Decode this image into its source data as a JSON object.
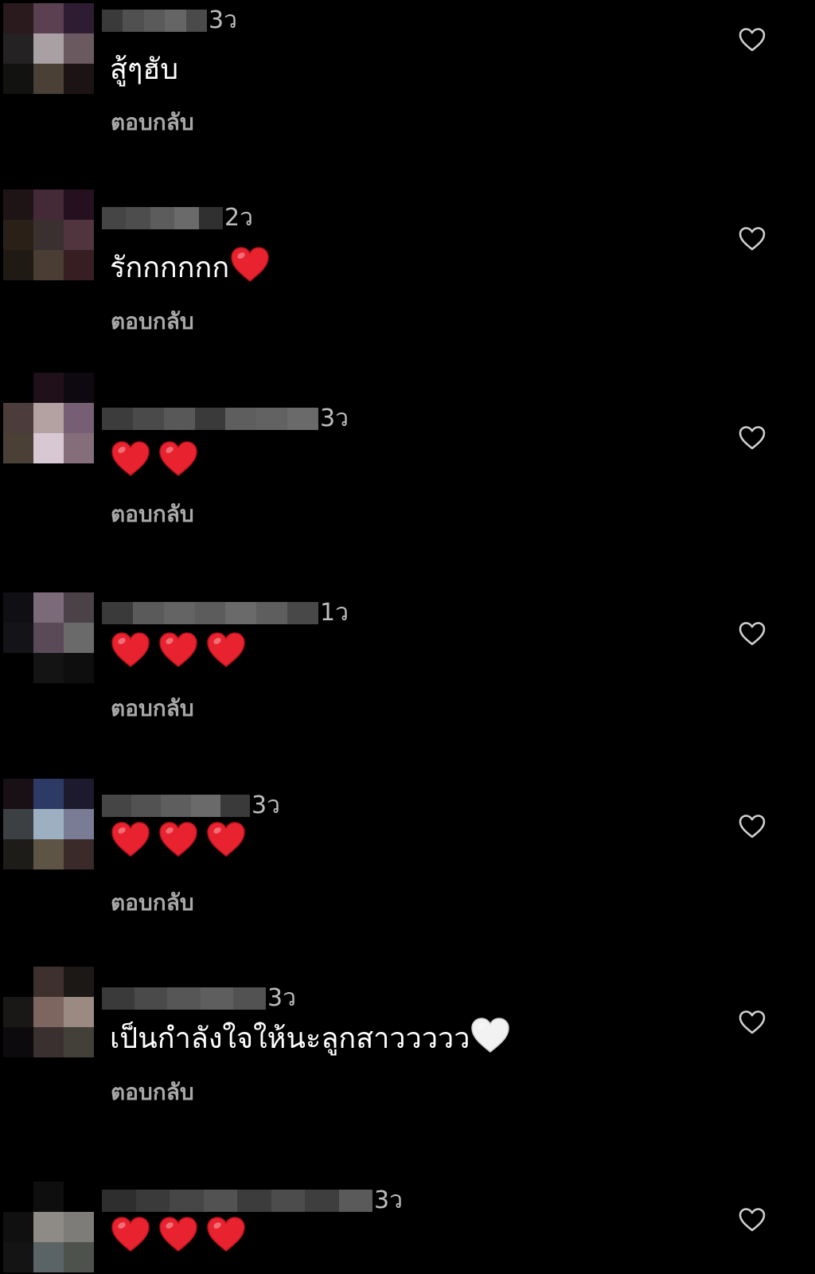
{
  "reply_label": "ตอบกลับ",
  "colors": {
    "background": "#000000",
    "comment_text": "#ffffff",
    "secondary_text": "#a8a8a8",
    "heart_emoji": "#e8232f",
    "like_icon": "#d0d0d0"
  },
  "comments": [
    {
      "time": "3ว",
      "text": "สู้ๆฮับ",
      "avatar_colors": [
        "#2a1a1e",
        "#5a4050",
        "#2e1c33",
        "#242222",
        "#a8a0a2",
        "#6a5a60",
        "#121210",
        "#4a4036",
        "#1c1414"
      ],
      "username_colors": [
        "#3a3a3a",
        "#505050",
        "#5a5a5a",
        "#656565",
        "#4a4a4a"
      ]
    },
    {
      "time": "2ว",
      "text": "รักกกกกก",
      "emojis": [
        "heart-red"
      ],
      "avatar_colors": [
        "#1e1416",
        "#442a36",
        "#24101e",
        "#2a2018",
        "#3a3030",
        "#50343e",
        "#201a14",
        "#4a3e34",
        "#361e22"
      ],
      "username_colors": [
        "#454545",
        "#4d4d4d",
        "#5c5c5c",
        "#6a6a6a",
        "#303030"
      ]
    },
    {
      "time": "3ว",
      "text": "",
      "emojis": [
        "heart-red",
        "heart-red"
      ],
      "avatar_colors": [
        "#000000",
        "#20101a",
        "#0e0810",
        "#4c3c3c",
        "#b4a2a2",
        "#765e74",
        "#4a4036",
        "#d8c8d4",
        "#846e7a"
      ],
      "username_colors": [
        "#3c3c3c",
        "#4a4a4a",
        "#585858",
        "#3a3a3a",
        "#5e5e5e",
        "#626262",
        "#6a6a6a"
      ]
    },
    {
      "time": "1ว",
      "text": "",
      "emojis": [
        "heart-red",
        "heart-red",
        "heart-red"
      ],
      "avatar_colors": [
        "#101014",
        "#7a6a7a",
        "#4a4246",
        "#141418",
        "#5a4a58",
        "#6a6a6a",
        "#000000",
        "#141414",
        "#0e0e0e"
      ],
      "username_colors": [
        "#3a3a3a",
        "#5a5a5a",
        "#646464",
        "#5c5c5c",
        "#6a6a6a",
        "#5e5e5e",
        "#484848"
      ]
    },
    {
      "time": "3ว",
      "text": "",
      "emojis": [
        "heart-red",
        "heart-red",
        "heart-red"
      ],
      "avatar_colors": [
        "#181014",
        "#2e3a66",
        "#1c1a2c",
        "#3c4042",
        "#9cb0c2",
        "#7a7c96",
        "#1e1c18",
        "#5e5446",
        "#3a2a2a"
      ],
      "username_colors": [
        "#454545",
        "#525252",
        "#5e5e5e",
        "#6a6a6a",
        "#3a3a3a"
      ]
    },
    {
      "time": "3ว",
      "text": "เป็นกำลังใจให้นะลูกสาววววว",
      "emojis": [
        "heart-white"
      ],
      "avatar_colors": [
        "#000000",
        "#3e302c",
        "#1c1816",
        "#1a1816",
        "#7e6660",
        "#9a8a82",
        "#0c0a0c",
        "#3a3030",
        "#424038"
      ],
      "username_colors": [
        "#3a3a3a",
        "#4a4a4a",
        "#565656",
        "#5e5e5e",
        "#525252"
      ]
    },
    {
      "time": "3ว",
      "text": "",
      "emojis": [
        "heart-red",
        "heart-red",
        "heart-red"
      ],
      "avatar_colors": [
        "#000000",
        "#0e0e0e",
        "#000000",
        "#101010",
        "#8e8a86",
        "#7e7c78",
        "#141414",
        "#5a6466",
        "#4e524c"
      ],
      "username_colors": [
        "#2e2e2e",
        "#3a3a3a",
        "#464646",
        "#525252",
        "#3c3c3c",
        "#4c4c4c",
        "#3e3e3e",
        "#5a5a5a"
      ]
    }
  ]
}
